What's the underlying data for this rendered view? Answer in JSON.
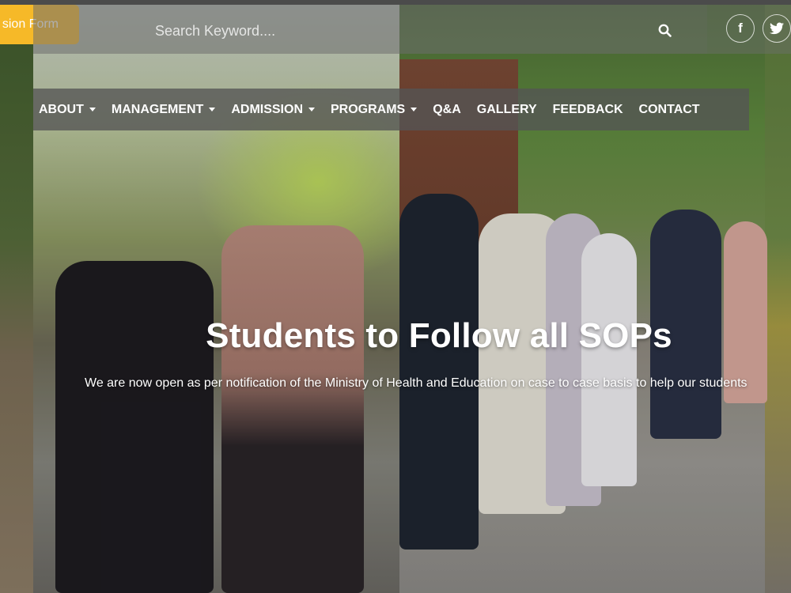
{
  "admission_button": {
    "label": "sion Form"
  },
  "search": {
    "placeholder": "Search Keyword...."
  },
  "social": {
    "facebook": "f",
    "twitter": "twitter-icon"
  },
  "nav": {
    "items": [
      {
        "label": "ABOUT",
        "dropdown": true
      },
      {
        "label": "MANAGEMENT",
        "dropdown": true
      },
      {
        "label": "ADMISSION",
        "dropdown": true
      },
      {
        "label": "PROGRAMS",
        "dropdown": true
      },
      {
        "label": "Q&A",
        "dropdown": false
      },
      {
        "label": "GALLERY",
        "dropdown": false
      },
      {
        "label": "FEEDBACK",
        "dropdown": false
      },
      {
        "label": "CONTACT",
        "dropdown": false
      }
    ]
  },
  "hero": {
    "title": "Students to Follow all SOPs",
    "subtitle": "We are now open as per notification of the Ministry of Health and Education on case to case basis to help our students"
  },
  "colors": {
    "accent": "#f6b928",
    "nav_bg": "#555555"
  }
}
